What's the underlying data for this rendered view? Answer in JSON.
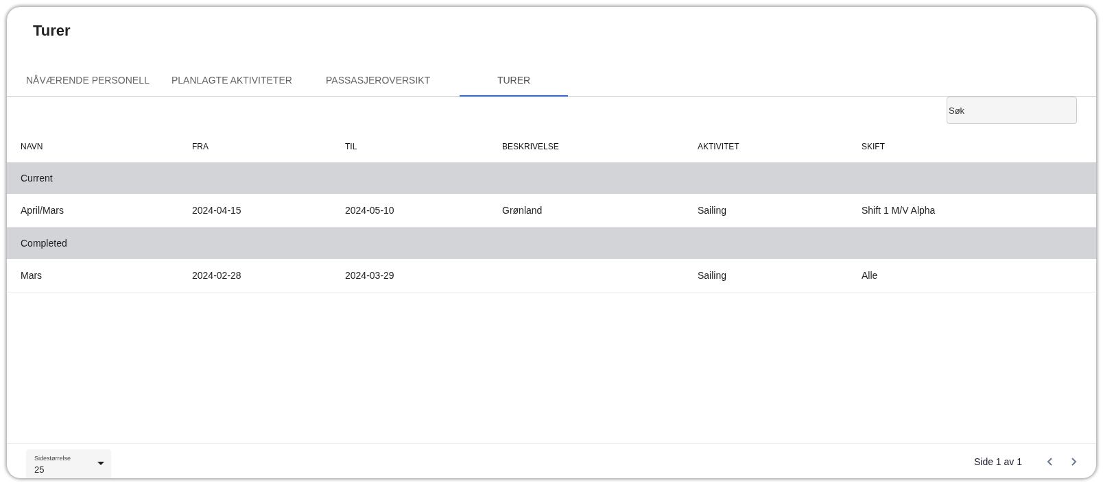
{
  "title": "Turer",
  "tabs": [
    {
      "label": "NÅVÆRENDE PERSONELL",
      "selected": false
    },
    {
      "label": "PLANLAGTE AKTIVITETER",
      "selected": false
    },
    {
      "label": "PASSASJEROVERSIKT",
      "selected": false
    },
    {
      "label": "TURER",
      "selected": true
    }
  ],
  "search": {
    "placeholder": "Søk"
  },
  "table": {
    "columns": [
      "NAVN",
      "FRA",
      "TIL",
      "BESKRIVELSE",
      "AKTIVITET",
      "SKIFT"
    ],
    "rows": [
      {
        "kind": "group",
        "label": "Current"
      },
      {
        "kind": "data",
        "cells": [
          "April/Mars",
          "2024-04-15",
          "2024-05-10",
          "Grønland",
          "Sailing",
          "Shift 1 M/V Alpha"
        ]
      },
      {
        "kind": "group",
        "label": "Completed"
      },
      {
        "kind": "data",
        "cells": [
          "Mars",
          "2024-02-28",
          "2024-03-29",
          "",
          "Sailing",
          "Alle"
        ]
      }
    ]
  },
  "footer": {
    "page_size_label": "Sidestørrelse",
    "page_size": "25",
    "page_info": "Side 1 av 1"
  }
}
